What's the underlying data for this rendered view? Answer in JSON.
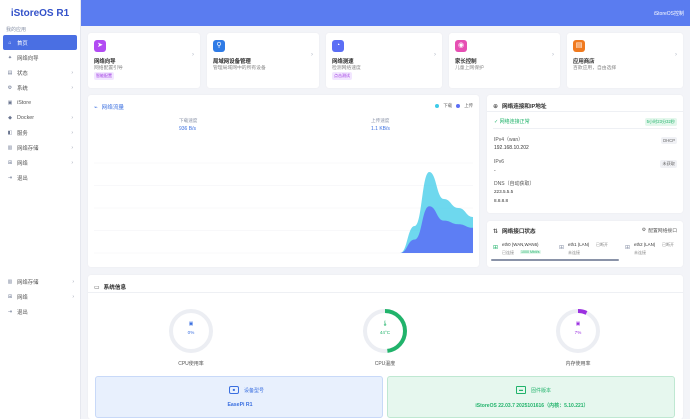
{
  "brand": "iStoreOS R1",
  "top_right": "iStoreOS控制",
  "menu_header": "我的应用",
  "menu": [
    {
      "label": "首页",
      "icon": "home-icon",
      "glyph": "⌂",
      "chev": false,
      "active": true
    },
    {
      "label": "网络向导",
      "icon": "wand-icon",
      "glyph": "✦",
      "chev": false
    },
    {
      "label": "状态",
      "icon": "status-icon",
      "glyph": "▤",
      "chev": true
    },
    {
      "label": "系统",
      "icon": "gear-icon",
      "glyph": "⚙",
      "chev": true
    },
    {
      "label": "iStore",
      "icon": "store-icon",
      "glyph": "▣",
      "chev": false
    },
    {
      "label": "Docker",
      "icon": "docker-icon",
      "glyph": "◆",
      "chev": true
    },
    {
      "label": "服务",
      "icon": "service-icon",
      "glyph": "◧",
      "chev": true
    },
    {
      "label": "网络存储",
      "icon": "storage-icon",
      "glyph": "▥",
      "chev": true
    },
    {
      "label": "网络",
      "icon": "network-icon",
      "glyph": "⊞",
      "chev": true
    },
    {
      "label": "退出",
      "icon": "logout-icon",
      "glyph": "⇥",
      "chev": false
    }
  ],
  "menu_bottom": [
    {
      "label": "网络存储",
      "icon": "storage-icon",
      "glyph": "▥",
      "chev": true
    },
    {
      "label": "网络",
      "icon": "network-icon",
      "glyph": "⊞",
      "chev": true
    },
    {
      "label": "退出",
      "icon": "logout-icon",
      "glyph": "⇥",
      "chev": false
    }
  ],
  "quick_cards": [
    {
      "title": "网络向导",
      "sub": "网络配置引导",
      "badge": "智能配置",
      "icon": "navigation-icon",
      "glyph": "➤",
      "color": "#b24bf3"
    },
    {
      "title": "局域网设备管理",
      "sub": "管理局域网中的所有设备",
      "badge": "",
      "icon": "devices-icon",
      "glyph": "⚲",
      "color": "#2f7be6"
    },
    {
      "title": "网络测速",
      "sub": "检测网络速度",
      "badge": "点击测试",
      "icon": "speedometer-icon",
      "glyph": "◔",
      "color": "#5b6ef5"
    },
    {
      "title": "家长控制",
      "sub": "儿童上网保护",
      "badge": "",
      "icon": "parental-icon",
      "glyph": "◉",
      "color": "#e64fb3"
    },
    {
      "title": "应用商店",
      "sub": "百款应用，自由选择",
      "badge": "",
      "icon": "shop-icon",
      "glyph": "▤",
      "color": "#f07a1f"
    }
  ],
  "traffic": {
    "title": "网络流量",
    "legend_down": "下载",
    "legend_up": "上传",
    "down_label": "下载速度",
    "down_value": "936 B/s",
    "up_label": "上传速度",
    "up_value": "1.1 KB/s",
    "colors": {
      "down": "#3ecbe8",
      "up": "#5b6ef5"
    }
  },
  "chart_data": {
    "type": "area",
    "title": "网络流量",
    "series": [
      {
        "name": "下载",
        "values": [
          0,
          0,
          0,
          0,
          0,
          0,
          0,
          0,
          0,
          0,
          0,
          0,
          0,
          0,
          0,
          0,
          0,
          0,
          0,
          0,
          0,
          0,
          0.3,
          0.9,
          0.6,
          0.5,
          0.4
        ]
      },
      {
        "name": "上传",
        "values": [
          0,
          0,
          0,
          0,
          0,
          0,
          0,
          0,
          0,
          0,
          0,
          0,
          0,
          0,
          0,
          0,
          0,
          0,
          0,
          0,
          0,
          0,
          0.15,
          0.52,
          0.36,
          0.32,
          0.28
        ]
      }
    ],
    "ylim": [
      0,
      1
    ],
    "grid": true
  },
  "netinfo": {
    "title": "网络连接和IP地址",
    "status": "网络连接正常",
    "status_badge": "5小时23分32秒",
    "ipv4_label": "IPv4（wan）",
    "ipv4_tag": "DHCP",
    "ipv4": "192.168.10.202",
    "ipv6_label": "IPv6",
    "ipv6_tag": "未获取",
    "ipv6": "-",
    "dns_label": "DNS（自动获取）",
    "dns1": "223.5.5.5",
    "dns2": "8.8.8.8"
  },
  "iface": {
    "title": "网络接口状态",
    "config": "配置网络接口",
    "ports": [
      {
        "name": "eth0 (WAN,WAN6)",
        "state": "已连接",
        "speed": "1000 Mbit/s"
      },
      {
        "name": "eth1 (LAN)",
        "tag": "已断开",
        "state": "未连接"
      },
      {
        "name": "eth2 (LAN)",
        "tag": "已断开",
        "state": "未连接"
      }
    ]
  },
  "sysinfo": {
    "title": "系统信息",
    "gauges": [
      {
        "label": "CPU使用率",
        "value": "0%",
        "pct": 0,
        "color": "#3a6fe0",
        "icon": "cpu-icon"
      },
      {
        "label": "CPU温度",
        "value": "44°C",
        "pct": 0.48,
        "color": "#21b36b",
        "icon": "thermometer-icon"
      },
      {
        "label": "内存使用率",
        "value": "7%",
        "pct": 0.07,
        "color": "#9b30e0",
        "icon": "memory-icon"
      }
    ],
    "device_label": "设备型号",
    "device_value": "EasePi R1",
    "firmware_label": "固件版本",
    "firmware_value": "iStoreOS 22.03.7 2025101616（内核：5.10.221）"
  }
}
